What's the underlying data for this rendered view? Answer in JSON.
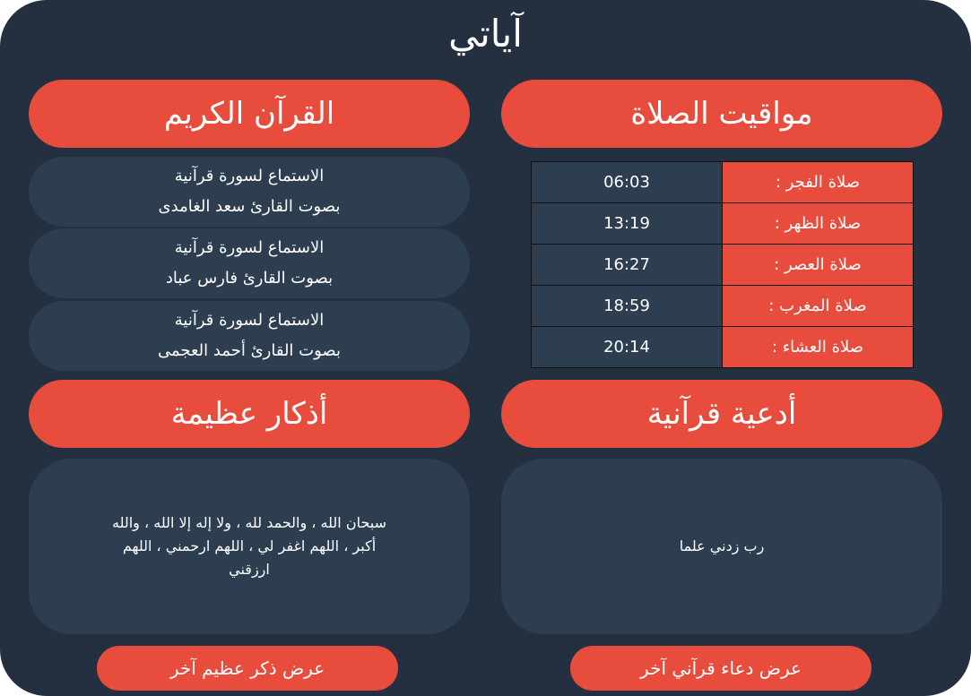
{
  "app": {
    "title": "آياتي"
  },
  "quran": {
    "title": "القرآن الكريم",
    "reciters": [
      {
        "line1": "الاستماع لسورة قرآنية",
        "line2": "بصوت القارئ سعد الغامدى"
      },
      {
        "line1": "الاستماع لسورة قرآنية",
        "line2": "بصوت القارئ فارس عباد"
      },
      {
        "line1": "الاستماع لسورة قرآنية",
        "line2": "بصوت القارئ أحمد العجمى"
      }
    ]
  },
  "prayer": {
    "title": "مواقيت الصلاة",
    "rows": [
      {
        "name": "صلاة الفجر :",
        "time": "06:03"
      },
      {
        "name": "صلاة الظهر :",
        "time": "13:19"
      },
      {
        "name": "صلاة العصر :",
        "time": "16:27"
      },
      {
        "name": "صلاة المغرب :",
        "time": "18:59"
      },
      {
        "name": "صلاة العشاء :",
        "time": "20:14"
      }
    ]
  },
  "adhkar": {
    "title": "أذكار عظيمة",
    "text": "سبحان الله ، والحمد لله ، ولا إله إلا الله ، والله أكبر ، اللهم اغفر لي ، اللهم ارحمني ، اللهم ارزقني",
    "button_label": "عرض ذكر عظيم آخر"
  },
  "duas": {
    "title": "أدعية قرآنية",
    "text": "رب زدني علما",
    "button_label": "عرض دعاء قرآني آخر"
  }
}
